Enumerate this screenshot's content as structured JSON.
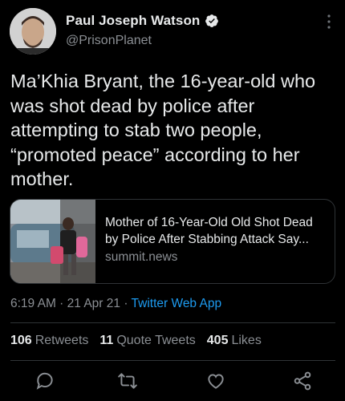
{
  "author": {
    "name": "Paul Joseph Watson",
    "handle": "@PrisonPlanet",
    "verified_icon": "verified-badge-icon"
  },
  "tweet": {
    "text": "Ma’Khia Bryant, the 16-year-old who was shot dead by police after attempting to stab two people, “promoted peace” according to her mother."
  },
  "link_card": {
    "title_line1": "Mother of 16-Year-Old Old Shot Dead",
    "title_line2": "by Police After Stabbing Attack Say...",
    "domain": "summit.news"
  },
  "meta": {
    "time": "6:19 AM",
    "date": "21 Apr 21",
    "source": "Twitter Web App",
    "sep": " · "
  },
  "stats": {
    "retweets_count": "106",
    "retweets_label": "Retweets",
    "quotes_count": "11",
    "quotes_label": "Quote Tweets",
    "likes_count": "405",
    "likes_label": "Likes"
  },
  "actions": [
    "reply-icon",
    "retweet-icon",
    "like-icon",
    "share-icon"
  ],
  "colors": {
    "background": "#000000",
    "link": "#1d9bf0",
    "muted": "#8b8f94",
    "text": "#e7e9ea"
  }
}
